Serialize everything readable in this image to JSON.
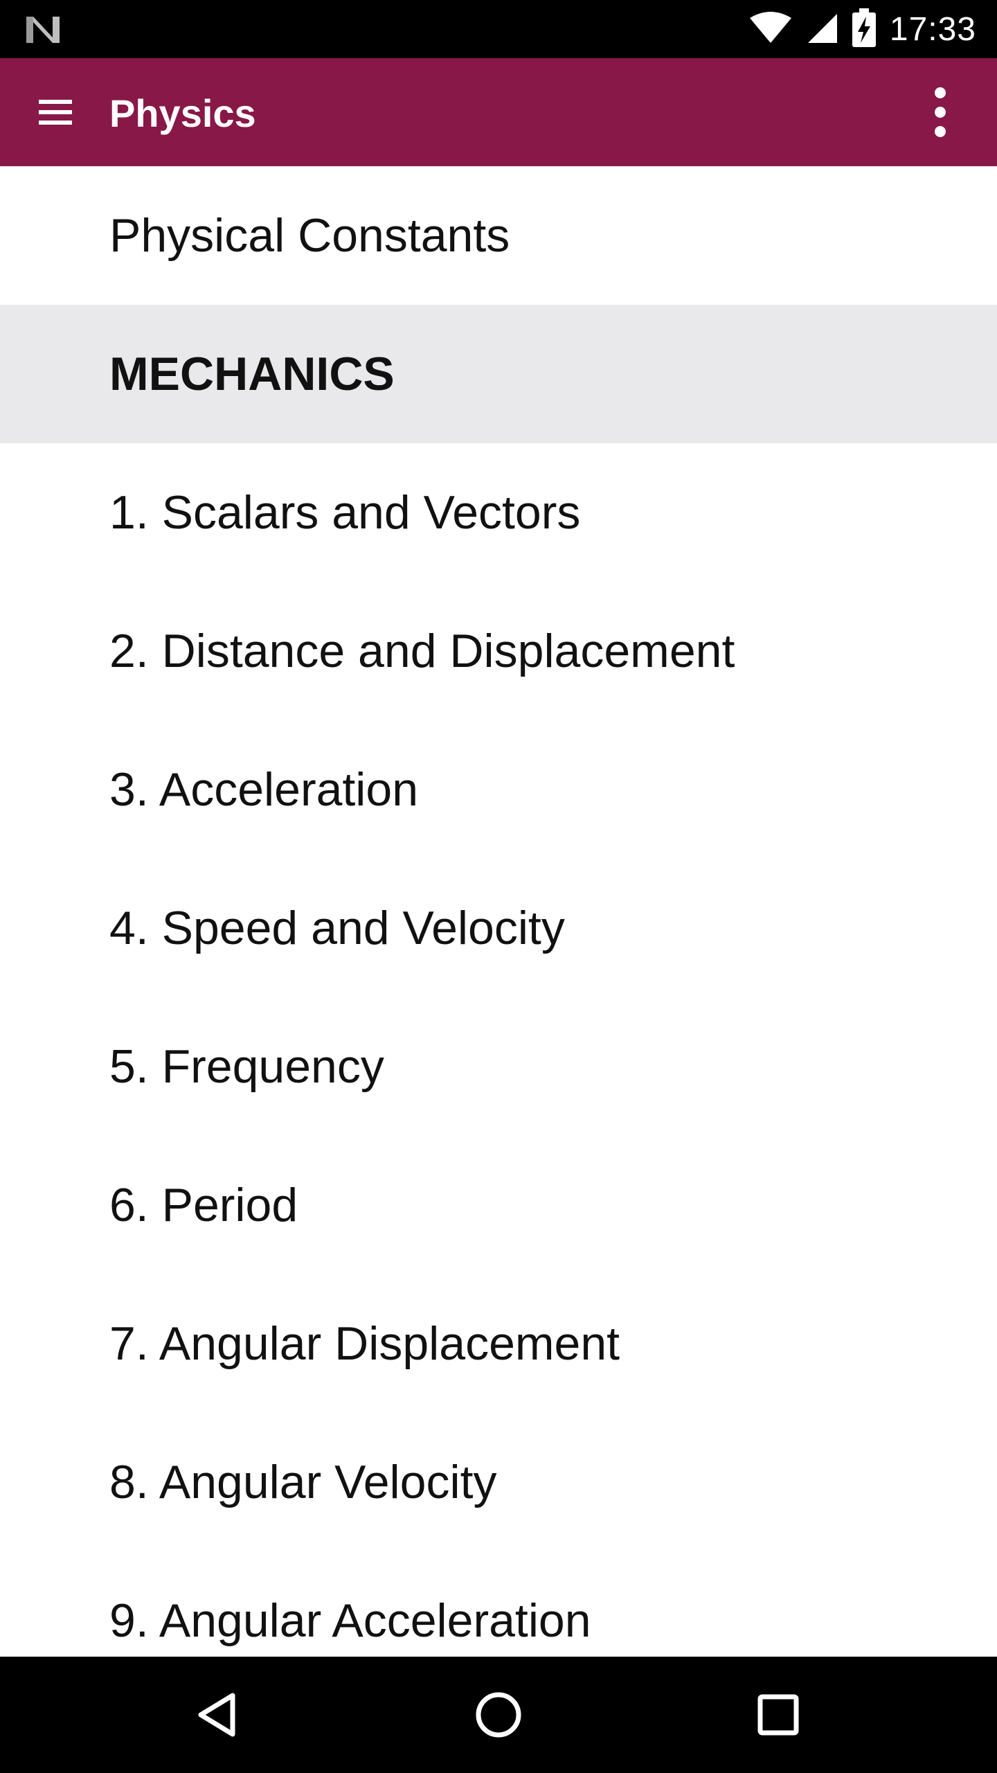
{
  "status_bar": {
    "time": "17:33",
    "icons": [
      "notification-n-icon",
      "wifi-icon",
      "cell-signal-icon",
      "battery-charging-icon"
    ]
  },
  "app_bar": {
    "title": "Physics",
    "icons": [
      "menu-icon",
      "overflow-menu-icon"
    ]
  },
  "list": {
    "top_item": "Physical Constants",
    "section_header": "MECHANICS",
    "items": [
      "1. Scalars and Vectors",
      "2. Distance and Displacement",
      "3. Acceleration",
      "4. Speed and Velocity",
      "5. Frequency",
      "6. Period",
      "7. Angular Displacement",
      "8. Angular Velocity",
      "9. Angular Acceleration"
    ]
  },
  "nav_bar": {
    "icons": [
      "back-icon",
      "home-icon",
      "recents-icon"
    ]
  },
  "colors": {
    "app_bar": "#871847",
    "section_header_bg": "#e9e8ea",
    "status_bar": "#000000",
    "nav_bar": "#000000"
  }
}
